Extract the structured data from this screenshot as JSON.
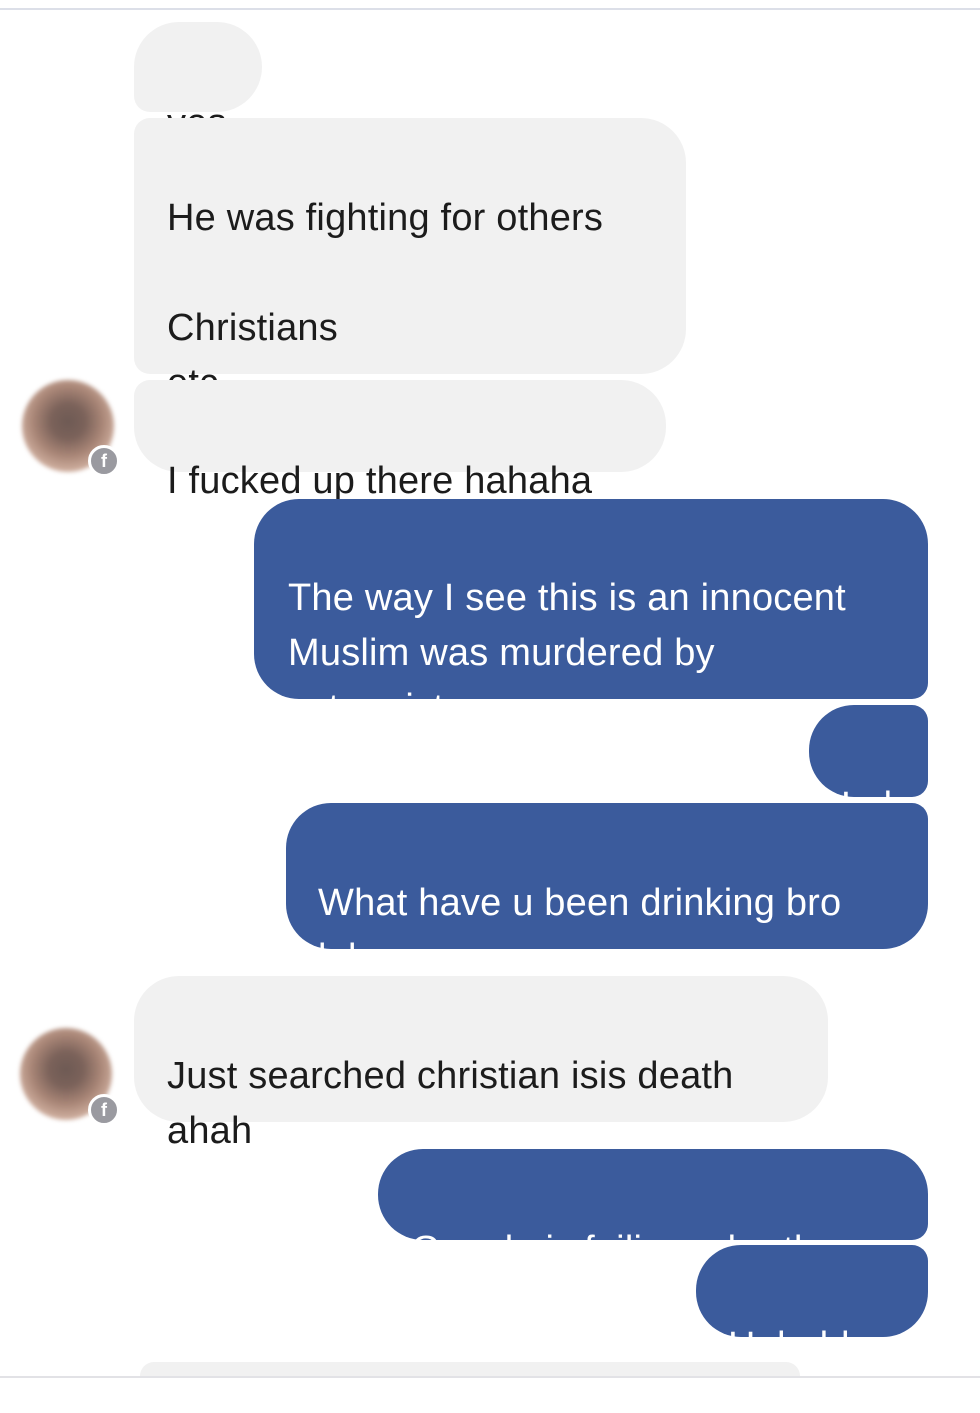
{
  "conversation": {
    "messages": [
      {
        "side": "received",
        "text": "yes"
      },
      {
        "side": "received",
        "text": "He was fighting for others\n\nChristians\netc"
      },
      {
        "side": "received",
        "text": "I fucked up there hahaha"
      },
      {
        "side": "sent",
        "text": "The way I see this is an innocent\nMuslim was murdered by\nextremist scums"
      },
      {
        "side": "sent",
        "text": "Lol"
      },
      {
        "side": "sent",
        "text": "What have u been drinking bro\nlol"
      },
      {
        "side": "received",
        "text": "Just searched christian isis death\nahah"
      },
      {
        "side": "sent",
        "text": "Google is failing u brother"
      },
      {
        "side": "sent",
        "text": "Hahahha"
      }
    ]
  },
  "colors": {
    "received_bubble": "#f1f1f1",
    "sent_bubble": "#3b5b9c",
    "received_text": "#1c1c1c",
    "sent_text": "#ffffff"
  },
  "icons": {
    "avatar_badge": "messenger-badge-icon"
  }
}
